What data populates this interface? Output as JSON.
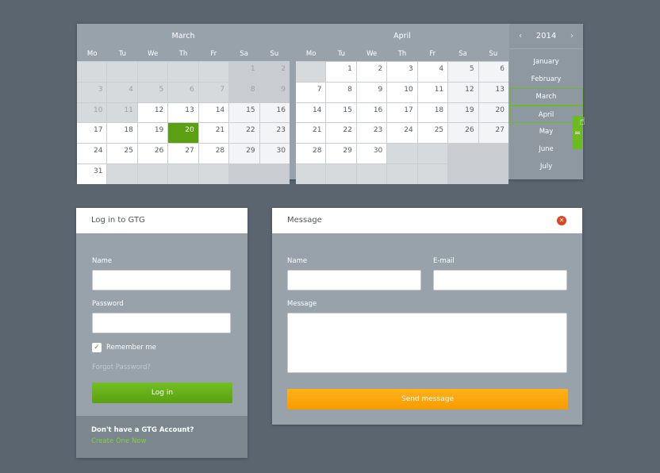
{
  "calendar": {
    "year": "2014",
    "prev_arrow": "‹",
    "next_arrow": "›",
    "weekdays": [
      "Mo",
      "Tu",
      "We",
      "Th",
      "Fr",
      "Sa",
      "Su"
    ],
    "months": [
      {
        "title": "March",
        "weeks": [
          [
            {
              "d": "",
              "t": "blank"
            },
            {
              "d": "",
              "t": "blank"
            },
            {
              "d": "",
              "t": "blank"
            },
            {
              "d": "",
              "t": "blank"
            },
            {
              "d": "",
              "t": "blank"
            },
            {
              "d": "1",
              "t": "other"
            },
            {
              "d": "2",
              "t": "other"
            }
          ],
          [
            {
              "d": "3",
              "t": "other"
            },
            {
              "d": "4",
              "t": "other"
            },
            {
              "d": "5",
              "t": "other"
            },
            {
              "d": "6",
              "t": "other"
            },
            {
              "d": "7",
              "t": "other"
            },
            {
              "d": "8",
              "t": "other"
            },
            {
              "d": "9",
              "t": "other"
            }
          ],
          [
            {
              "d": "10",
              "t": "other"
            },
            {
              "d": "11",
              "t": "other"
            },
            {
              "d": "12",
              "t": "cur"
            },
            {
              "d": "13",
              "t": "cur"
            },
            {
              "d": "14",
              "t": "cur"
            },
            {
              "d": "15",
              "t": "cur"
            },
            {
              "d": "16",
              "t": "cur"
            }
          ],
          [
            {
              "d": "17",
              "t": "cur"
            },
            {
              "d": "18",
              "t": "cur"
            },
            {
              "d": "19",
              "t": "cur"
            },
            {
              "d": "20",
              "t": "today"
            },
            {
              "d": "21",
              "t": "cur"
            },
            {
              "d": "22",
              "t": "cur"
            },
            {
              "d": "23",
              "t": "cur"
            }
          ],
          [
            {
              "d": "24",
              "t": "cur"
            },
            {
              "d": "25",
              "t": "cur"
            },
            {
              "d": "26",
              "t": "cur"
            },
            {
              "d": "27",
              "t": "cur"
            },
            {
              "d": "28",
              "t": "cur"
            },
            {
              "d": "29",
              "t": "cur"
            },
            {
              "d": "30",
              "t": "cur"
            }
          ],
          [
            {
              "d": "31",
              "t": "cur"
            },
            {
              "d": "",
              "t": "blank"
            },
            {
              "d": "",
              "t": "blank"
            },
            {
              "d": "",
              "t": "blank"
            },
            {
              "d": "",
              "t": "blank"
            },
            {
              "d": "",
              "t": "blank"
            },
            {
              "d": "",
              "t": "blank"
            }
          ]
        ]
      },
      {
        "title": "April",
        "weeks": [
          [
            {
              "d": "",
              "t": "blank"
            },
            {
              "d": "1",
              "t": "cur"
            },
            {
              "d": "2",
              "t": "cur"
            },
            {
              "d": "3",
              "t": "cur"
            },
            {
              "d": "4",
              "t": "cur"
            },
            {
              "d": "5",
              "t": "cur"
            },
            {
              "d": "6",
              "t": "cur"
            }
          ],
          [
            {
              "d": "7",
              "t": "cur"
            },
            {
              "d": "8",
              "t": "cur"
            },
            {
              "d": "9",
              "t": "cur"
            },
            {
              "d": "10",
              "t": "cur"
            },
            {
              "d": "11",
              "t": "cur"
            },
            {
              "d": "12",
              "t": "cur"
            },
            {
              "d": "13",
              "t": "cur"
            }
          ],
          [
            {
              "d": "14",
              "t": "cur"
            },
            {
              "d": "15",
              "t": "cur"
            },
            {
              "d": "16",
              "t": "cur"
            },
            {
              "d": "17",
              "t": "cur"
            },
            {
              "d": "18",
              "t": "cur"
            },
            {
              "d": "19",
              "t": "cur"
            },
            {
              "d": "20",
              "t": "cur"
            }
          ],
          [
            {
              "d": "21",
              "t": "cur"
            },
            {
              "d": "22",
              "t": "cur"
            },
            {
              "d": "23",
              "t": "cur"
            },
            {
              "d": "24",
              "t": "cur"
            },
            {
              "d": "25",
              "t": "cur"
            },
            {
              "d": "26",
              "t": "cur"
            },
            {
              "d": "27",
              "t": "cur"
            }
          ],
          [
            {
              "d": "28",
              "t": "cur"
            },
            {
              "d": "29",
              "t": "cur"
            },
            {
              "d": "30",
              "t": "cur"
            },
            {
              "d": "",
              "t": "blank"
            },
            {
              "d": "",
              "t": "blank"
            },
            {
              "d": "",
              "t": "blank"
            },
            {
              "d": "",
              "t": "blank"
            }
          ],
          [
            {
              "d": "",
              "t": "blank"
            },
            {
              "d": "",
              "t": "blank"
            },
            {
              "d": "",
              "t": "blank"
            },
            {
              "d": "",
              "t": "blank"
            },
            {
              "d": "",
              "t": "blank"
            },
            {
              "d": "",
              "t": "blank"
            },
            {
              "d": "",
              "t": "blank"
            }
          ]
        ]
      }
    ],
    "month_list": [
      {
        "label": "January",
        "selected": false
      },
      {
        "label": "February",
        "selected": false
      },
      {
        "label": "March",
        "selected": true
      },
      {
        "label": "April",
        "selected": true
      },
      {
        "label": "May",
        "selected": false
      },
      {
        "label": "June",
        "selected": false
      },
      {
        "label": "July",
        "selected": false
      }
    ]
  },
  "login": {
    "title": "Log in to GTG",
    "name_label": "Name",
    "name_value": "",
    "password_label": "Password",
    "password_value": "",
    "remember_label": "Remember me",
    "remember_checked": true,
    "forgot_label": "Forgot Password?",
    "submit_label": "Log in",
    "footer_question": "Don't have a GTG Account?",
    "footer_link": "Create One Now"
  },
  "message": {
    "title": "Message",
    "name_label": "Name",
    "name_value": "",
    "email_label": "E-mail",
    "email_value": "",
    "message_label": "Message",
    "message_value": "",
    "send_label": "Send message"
  },
  "colors": {
    "background": "#5b6570",
    "panel": "#98a2ab",
    "accent_green": "#5aa012",
    "accent_orange": "#f79b00",
    "close_red": "#d9461f"
  }
}
